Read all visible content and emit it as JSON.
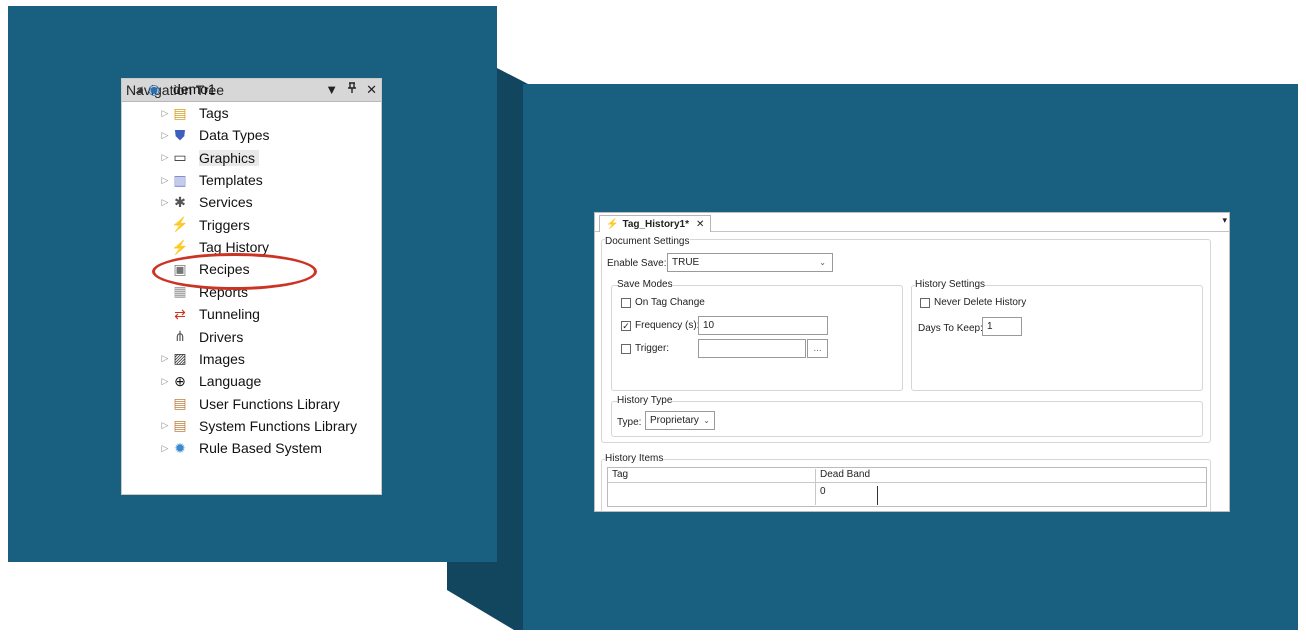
{
  "colors": {
    "background_blue": "#185f80",
    "highlight_red": "#cc3322"
  },
  "navigation_tree": {
    "title": "Navigation Tree",
    "controls": {
      "dropdown_icon": "▼",
      "pin_icon": "ᵾ",
      "close_icon": "✕"
    },
    "root": {
      "label": "demo1",
      "icon": "project-icon"
    },
    "items": [
      {
        "label": "Tags",
        "icon": "tags-icon",
        "expandable": true
      },
      {
        "label": "Data Types",
        "icon": "data-types-icon",
        "expandable": true
      },
      {
        "label": "Graphics",
        "icon": "graphics-icon",
        "expandable": true,
        "selected": true
      },
      {
        "label": "Templates",
        "icon": "templates-icon",
        "expandable": true
      },
      {
        "label": "Services",
        "icon": "services-icon",
        "expandable": true
      },
      {
        "label": "Triggers",
        "icon": "triggers-icon",
        "expandable": false
      },
      {
        "label": "Tag History",
        "icon": "tag-history-icon",
        "expandable": false,
        "highlighted": true
      },
      {
        "label": "Recipes",
        "icon": "recipes-icon",
        "expandable": false
      },
      {
        "label": "Reports",
        "icon": "reports-icon",
        "expandable": false
      },
      {
        "label": "Tunneling",
        "icon": "tunneling-icon",
        "expandable": false
      },
      {
        "label": "Drivers",
        "icon": "drivers-icon",
        "expandable": false
      },
      {
        "label": "Images",
        "icon": "images-icon",
        "expandable": true
      },
      {
        "label": "Language",
        "icon": "language-icon",
        "expandable": true
      },
      {
        "label": "User Functions Library",
        "icon": "library-icon",
        "expandable": false
      },
      {
        "label": "System Functions Library",
        "icon": "library-icon",
        "expandable": true
      },
      {
        "label": "Rule Based System",
        "icon": "gear-icon",
        "expandable": true
      }
    ]
  },
  "document": {
    "tab_label": "Tag_History1*",
    "document_settings": {
      "legend": "Document Settings",
      "enable_save_label": "Enable Save:",
      "enable_save_value": "TRUE"
    },
    "save_modes": {
      "legend": "Save Modes",
      "on_tag_change_label": "On Tag Change",
      "on_tag_change_checked": false,
      "frequency_label": "Frequency (s):",
      "frequency_checked": true,
      "frequency_value": "10",
      "trigger_label": "Trigger:",
      "trigger_checked": false,
      "trigger_value": "",
      "browse_label": "..."
    },
    "history_settings": {
      "legend": "History Settings",
      "never_delete_label": "Never Delete History",
      "never_delete_checked": false,
      "days_to_keep_label": "Days To Keep:",
      "days_to_keep_value": "1"
    },
    "history_type": {
      "legend": "History Type",
      "type_label": "Type:",
      "type_value": "Proprietary"
    },
    "history_items": {
      "legend": "History Items",
      "columns": [
        "Tag",
        "Dead Band"
      ],
      "rows": [
        {
          "tag": "",
          "dead_band": "0"
        }
      ]
    }
  }
}
